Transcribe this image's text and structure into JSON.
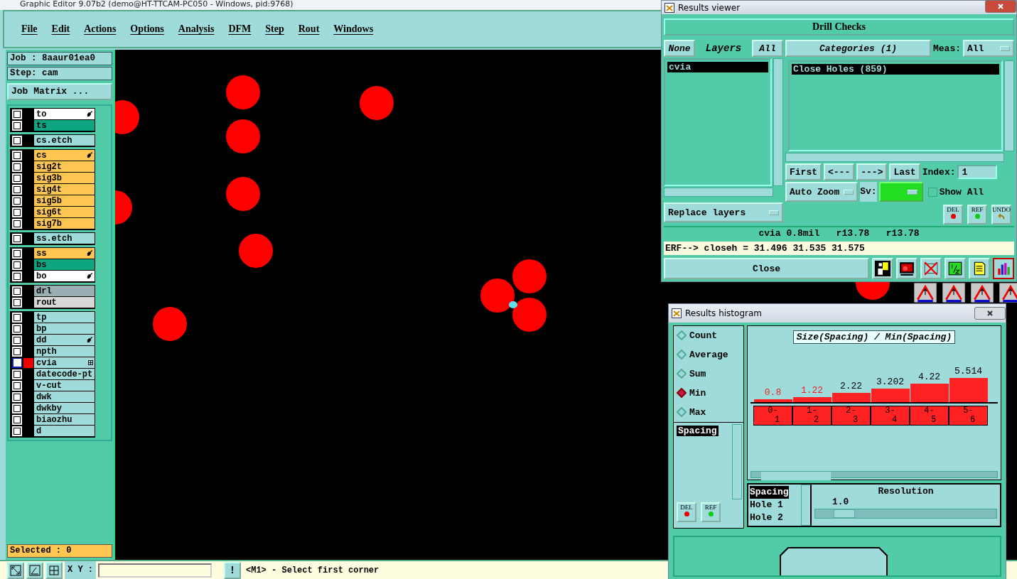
{
  "main": {
    "title": "Graphic Editor 9.07b2 (demo@HT-TTCAM-PC050 - Windows, pid:9768)",
    "menu": [
      "File",
      "Edit",
      "Actions",
      "Options",
      "Analysis",
      "DFM",
      "Step",
      "Rout",
      "Windows"
    ]
  },
  "job": {
    "job": "Job : 8aaur01ea0",
    "step": "Step: cam",
    "matrix_button": "Job Matrix ..."
  },
  "layer_groups": [
    {
      "layers": [
        {
          "name": "to",
          "color": "#ffffff",
          "pointer": true,
          "selected": false,
          "checked": false
        },
        {
          "name": "ts",
          "color": "#0ea680",
          "pointer": false,
          "selected": false,
          "checked": false
        }
      ]
    },
    {
      "layers": [
        {
          "name": "cs.etch",
          "color": "#9fdbda",
          "pointer": false,
          "selected": false,
          "checked": false
        }
      ]
    },
    {
      "layers": [
        {
          "name": "cs",
          "color": "#ffc652",
          "pointer": true,
          "selected": false,
          "checked": false
        },
        {
          "name": "sig2t",
          "color": "#ffc652",
          "pointer": false,
          "selected": false,
          "checked": false
        },
        {
          "name": "sig3b",
          "color": "#ffc652",
          "pointer": false,
          "selected": false,
          "checked": false
        },
        {
          "name": "sig4t",
          "color": "#ffc652",
          "pointer": false,
          "selected": false,
          "checked": false
        },
        {
          "name": "sig5b",
          "color": "#ffc652",
          "pointer": false,
          "selected": false,
          "checked": false
        },
        {
          "name": "sig6t",
          "color": "#ffc652",
          "pointer": false,
          "selected": false,
          "checked": false
        },
        {
          "name": "sig7b",
          "color": "#ffc652",
          "pointer": false,
          "selected": false,
          "checked": false
        }
      ]
    },
    {
      "layers": [
        {
          "name": "ss.etch",
          "color": "#9fdbda",
          "pointer": false,
          "selected": false,
          "checked": false
        }
      ]
    },
    {
      "layers": [
        {
          "name": "ss",
          "color": "#ffc652",
          "pointer": true,
          "selected": false,
          "checked": false
        },
        {
          "name": "bs",
          "color": "#0ea680",
          "pointer": false,
          "selected": false,
          "checked": false
        },
        {
          "name": "bo",
          "color": "#ffffff",
          "pointer": true,
          "selected": false,
          "checked": false
        }
      ]
    },
    {
      "layers": [
        {
          "name": "drl",
          "color": "#9aafb4",
          "pointer": false,
          "selected": false,
          "checked": false
        },
        {
          "name": "rout",
          "color": "#d8d8d8",
          "pointer": false,
          "selected": false,
          "checked": false
        }
      ]
    },
    {
      "layers": [
        {
          "name": "tp",
          "color": "#9fdbda",
          "pointer": false,
          "selected": false,
          "checked": false
        },
        {
          "name": "bp",
          "color": "#9fdbda",
          "pointer": false,
          "selected": false,
          "checked": false
        },
        {
          "name": "dd",
          "color": "#9fdbda",
          "pointer": true,
          "selected": false,
          "checked": false
        },
        {
          "name": "npth",
          "color": "#9fdbda",
          "pointer": false,
          "selected": false,
          "checked": false
        },
        {
          "name": "cvia",
          "color": "#9fdbda",
          "pointer": false,
          "selected": true,
          "checked": false
        },
        {
          "name": "datecode-pt",
          "color": "#9fdbda",
          "pointer": false,
          "selected": false,
          "checked": false
        },
        {
          "name": "v-cut",
          "color": "#9fdbda",
          "pointer": false,
          "selected": false,
          "checked": false
        },
        {
          "name": "dwk",
          "color": "#9fdbda",
          "pointer": false,
          "selected": false,
          "checked": false
        },
        {
          "name": "dwkby",
          "color": "#9fdbda",
          "pointer": false,
          "selected": false,
          "checked": false
        },
        {
          "name": "biaozhu",
          "color": "#9fdbda",
          "pointer": false,
          "selected": false,
          "checked": false
        },
        {
          "name": "d",
          "color": "#9fdbda",
          "pointer": false,
          "selected": false,
          "checked": false
        }
      ]
    }
  ],
  "selected_count": "Selected : 0",
  "bottom": {
    "xy_label": "X Y :",
    "alert": "!",
    "prompt": "<M1> - Select first corner"
  },
  "viewer": {
    "title": "Results viewer",
    "heading": "Drill Checks",
    "layer_buttons": [
      {
        "label": "None",
        "selected": false
      },
      {
        "label": "Layers",
        "selected": true
      },
      {
        "label": "All",
        "selected": false
      }
    ],
    "layers": [
      {
        "name": "cvia",
        "selected": true
      }
    ],
    "categories_button": "Categories (1)",
    "meas_label": "Meas:",
    "meas_value": "All",
    "categories": [
      {
        "name": "Close Holes (859)",
        "selected": true
      }
    ],
    "nav": [
      "First",
      "<---",
      "--->",
      "Last"
    ],
    "index_label": "Index:",
    "index_value": "1",
    "zoom_mode": "Auto Zoom",
    "sv_label": "Sv:",
    "show_all": {
      "label": "Show All",
      "checked": false
    },
    "replace_mode": "Replace layers",
    "tool_buttons": [
      {
        "label": "DEL",
        "kind": "del"
      },
      {
        "label": "REF",
        "kind": "ref"
      },
      {
        "label": "UNDO",
        "kind": "undo"
      }
    ],
    "info": "cvia 0.8mil   r13.78   r13.78",
    "erf": "ERF--> closeh = 31.496 31.535 31.575",
    "close_button": "Close"
  },
  "histogram": {
    "title": "Results histogram",
    "modes": [
      {
        "label": "Count",
        "selected": false
      },
      {
        "label": "Average",
        "selected": false
      },
      {
        "label": "Sum",
        "selected": false
      },
      {
        "label": "Min",
        "selected": true
      },
      {
        "label": "Max",
        "selected": false
      }
    ],
    "attributes": [
      {
        "label": "Spacing",
        "selected": true
      }
    ],
    "buttons": [
      {
        "label": "DEL",
        "kind": "del"
      },
      {
        "label": "REF",
        "kind": "ref"
      }
    ],
    "chart_data": {
      "type": "bar",
      "title": "Size(Spacing) / Min(Spacing)",
      "categories": [
        "0-1",
        "1-2",
        "2-3",
        "3-4",
        "4-5",
        "5-6"
      ],
      "values": [
        0.8,
        1.22,
        2.22,
        3.202,
        4.22,
        5.514
      ],
      "data_labels": true
    },
    "flagged": [
      true,
      true,
      false,
      false,
      false,
      false
    ],
    "fields": [
      {
        "label": "Spacing",
        "selected": true
      },
      {
        "label": "Hole 1",
        "selected": false
      },
      {
        "label": "Hole 2",
        "selected": false
      }
    ],
    "resolution_label": "Resolution",
    "resolution_value": "1.0",
    "resolution": {
      "level": 0.1
    }
  }
}
